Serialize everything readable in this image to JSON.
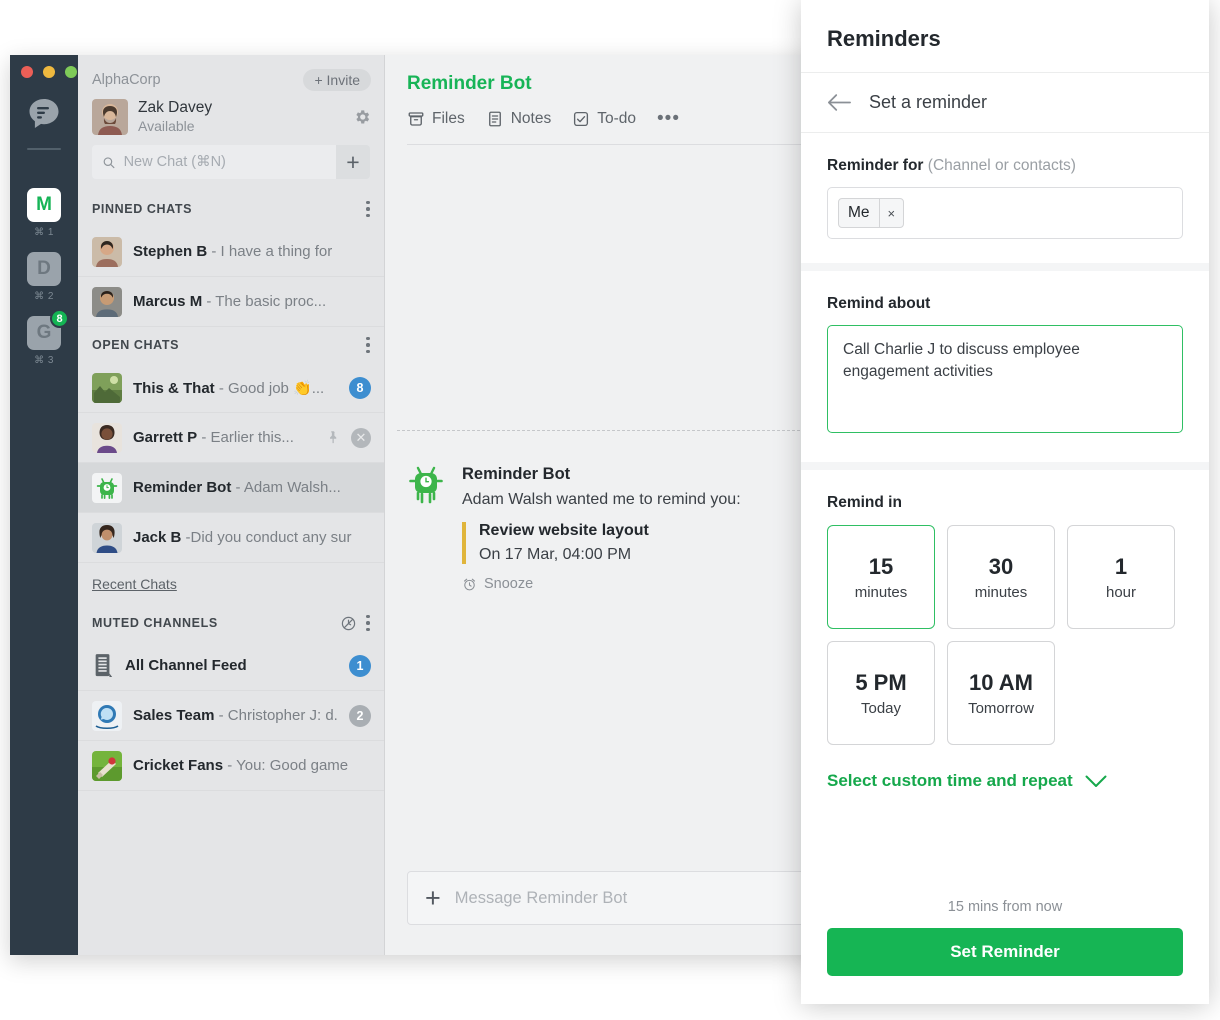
{
  "rail": {
    "logo_icon": "chat-logo-icon",
    "teams": [
      {
        "letter": "M",
        "shortcut": "⌘ 1",
        "active": true,
        "badge": null
      },
      {
        "letter": "D",
        "shortcut": "⌘ 2",
        "active": false,
        "badge": null
      },
      {
        "letter": "G",
        "shortcut": "⌘ 3",
        "active": false,
        "badge": "8"
      }
    ]
  },
  "sidebar": {
    "org_name": "AlphaCorp",
    "invite_label": "+ Invite",
    "user": {
      "name": "Zak Davey",
      "status": "Available"
    },
    "settings_icon": "gear-icon",
    "search": {
      "placeholder": "New Chat (⌘N)",
      "value": "",
      "icon": "search-icon",
      "add_label": "+"
    },
    "sections": [
      {
        "title": "PINNED CHATS",
        "rows": [
          {
            "name": "Stephen B",
            "preview": " - I have a thing for",
            "badge": null,
            "badge_color": null,
            "pinned": false,
            "closable": false,
            "selected": false
          },
          {
            "name": "Marcus M",
            "preview": " - The basic proc...",
            "badge": null,
            "badge_color": null,
            "pinned": false,
            "closable": false,
            "selected": false
          }
        ]
      },
      {
        "title": "OPEN CHATS",
        "rows": [
          {
            "name": "This & That",
            "preview": " - Good job 👏...",
            "badge": "8",
            "badge_color": "blue",
            "pinned": false,
            "closable": false,
            "selected": false
          },
          {
            "name": "Garrett P",
            "preview": " - Earlier this...",
            "badge": null,
            "badge_color": null,
            "pinned": true,
            "closable": true,
            "selected": false
          },
          {
            "name": "Reminder Bot",
            "preview": " - Adam Walsh...",
            "badge": null,
            "badge_color": null,
            "pinned": false,
            "closable": false,
            "selected": true
          },
          {
            "name": "Jack B",
            "preview": " -Did you conduct any sur",
            "badge": null,
            "badge_color": null,
            "pinned": false,
            "closable": false,
            "selected": false
          }
        ]
      },
      {
        "title": "MUTED CHANNELS",
        "rows": [
          {
            "name": "All Channel Feed",
            "preview": "",
            "badge": "1",
            "badge_color": "blue",
            "pinned": false,
            "closable": false,
            "selected": false
          },
          {
            "name": "Sales Team",
            "preview": " - Christopher J: d.",
            "badge": "2",
            "badge_color": "grey",
            "pinned": false,
            "closable": false,
            "selected": false
          },
          {
            "name": "Cricket Fans",
            "preview": " - You: Good game",
            "badge": null,
            "badge_color": null,
            "pinned": false,
            "closable": false,
            "selected": false
          }
        ]
      }
    ],
    "recent_chats_label": "Recent Chats"
  },
  "conversation": {
    "title": "Reminder Bot",
    "tabs": [
      {
        "label": "Files",
        "icon": "archive-icon"
      },
      {
        "label": "Notes",
        "icon": "note-icon"
      },
      {
        "label": "To-do",
        "icon": "checkbox-icon"
      }
    ],
    "more_label": "•••",
    "message": {
      "sender": "Reminder Bot",
      "line": "Adam Walsh wanted me to remind you:",
      "quote_title": "Review website layout",
      "quote_time": "On 17 Mar, 04:00 PM",
      "snooze_label": "Snooze",
      "snooze_icon": "alarm-icon"
    },
    "composer": {
      "placeholder": "Message Reminder Bot",
      "plus_icon": "plus-icon"
    }
  },
  "panel": {
    "title": "Reminders",
    "back_icon": "back-arrow-icon",
    "subtitle": "Set a reminder",
    "reminder_for": {
      "label": "Reminder for",
      "hint": "(Channel or contacts)",
      "chips": [
        {
          "label": "Me",
          "remove": "×"
        }
      ]
    },
    "remind_about": {
      "label": "Remind about",
      "value": "Call Charlie J to discuss employee engagement activities"
    },
    "remind_in": {
      "label": "Remind in",
      "options": [
        {
          "big": "15",
          "small": "minutes",
          "selected": true
        },
        {
          "big": "30",
          "small": "minutes",
          "selected": false
        },
        {
          "big": "1",
          "small": "hour",
          "selected": false
        },
        {
          "big": "5 PM",
          "small": "Today",
          "selected": false
        },
        {
          "big": "10 AM",
          "small": "Tomorrow",
          "selected": false
        }
      ]
    },
    "custom_link": {
      "label": "Select custom time and repeat",
      "icon": "chevron-down-icon"
    },
    "footer_note": "15 mins from now",
    "cta_label": "Set Reminder"
  },
  "colors": {
    "accent_green": "#16b554",
    "rail_dark": "#2e3b47",
    "badge_blue": "#3d8ed0",
    "badge_grey": "#a9aeb3",
    "quote_bar": "#e0b53b"
  }
}
